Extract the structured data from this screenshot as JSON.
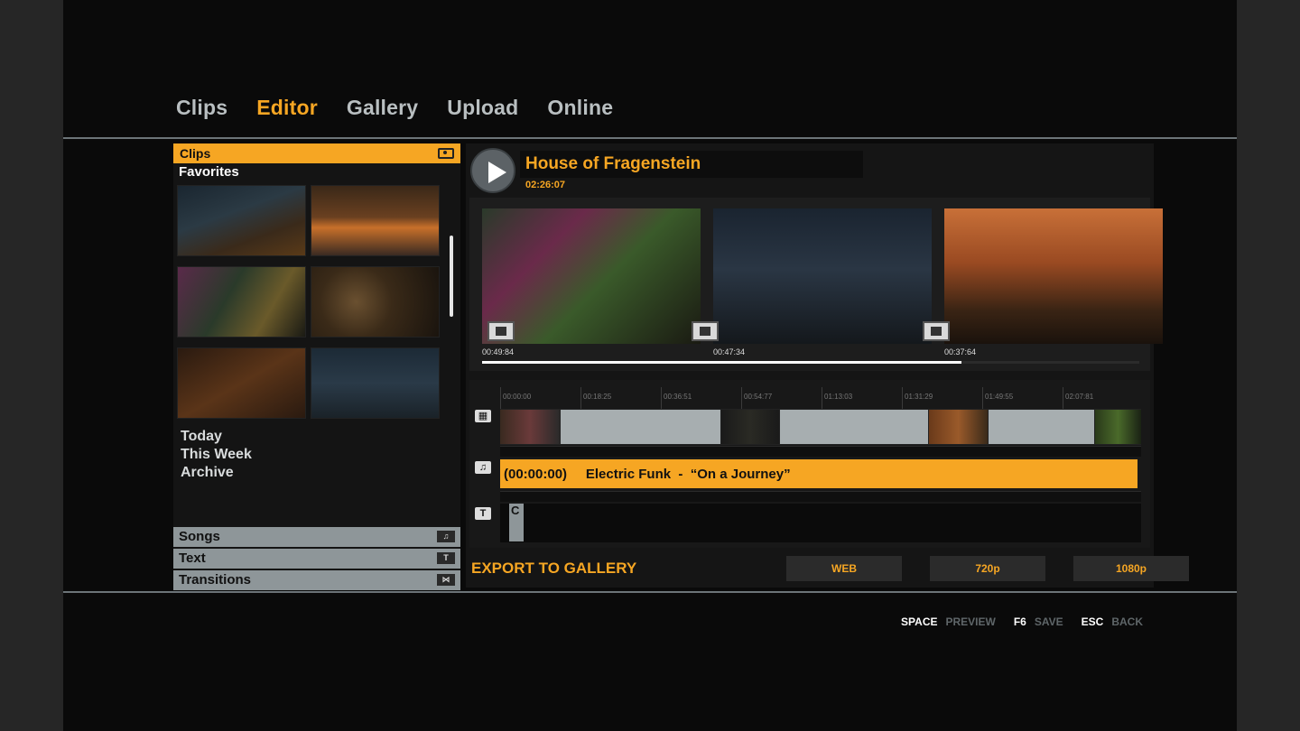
{
  "nav": {
    "tabs": [
      {
        "label": "Clips",
        "active": false
      },
      {
        "label": "Editor",
        "active": true
      },
      {
        "label": "Gallery",
        "active": false
      },
      {
        "label": "Upload",
        "active": false
      },
      {
        "label": "Online",
        "active": false
      }
    ]
  },
  "library": {
    "header": "Clips",
    "favorites_label": "Favorites",
    "dates": [
      "Today",
      "This Week",
      "Archive"
    ],
    "tabs": [
      {
        "label": "Songs",
        "icon": "music-note-icon"
      },
      {
        "label": "Text",
        "icon": "text-t-icon"
      },
      {
        "label": "Transitions",
        "icon": "bowtie-icon"
      }
    ]
  },
  "project": {
    "title": "House of Fragenstein",
    "duration": "02:26:07"
  },
  "preview": {
    "times": [
      "00:49:84",
      "00:47:34",
      "00:37:64"
    ],
    "progress": 0.73
  },
  "timeline": {
    "ruler_labels": [
      "00:00:00",
      "00:18:25",
      "00:36:51",
      "00:54:77",
      "01:13:03",
      "01:31:29",
      "01:49:55",
      "02:07:81"
    ],
    "audio_text": "(00:00:00)     Electric Funk  -  “On a Journey”",
    "text_clip_label": "C"
  },
  "export": {
    "label": "EXPORT TO GALLERY",
    "options": [
      "WEB",
      "720p",
      "1080p"
    ]
  },
  "hints": [
    {
      "key": "SPACE",
      "action": "PREVIEW"
    },
    {
      "key": "F6",
      "action": "SAVE"
    },
    {
      "key": "ESC",
      "action": "BACK"
    }
  ],
  "colors": {
    "accent": "#f6a623",
    "panel": "#151515",
    "muted": "#8e9699"
  }
}
